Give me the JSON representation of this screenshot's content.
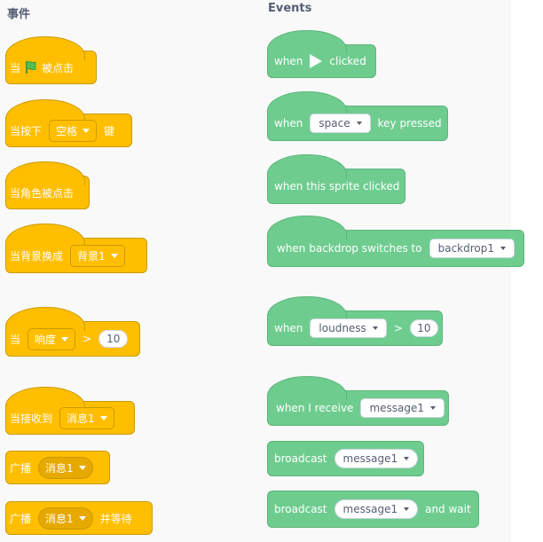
{
  "left": {
    "title": "事件",
    "b1": {
      "pre": "当",
      "post": "被点击"
    },
    "b2": {
      "pre": "当按下",
      "dd": "空格",
      "post": "键"
    },
    "b3": {
      "text": "当角色被点击"
    },
    "b4": {
      "pre": "当背景换成",
      "dd": "背景1"
    },
    "b5": {
      "pre": "当",
      "dd": "响度",
      "op": ">",
      "val": "10"
    },
    "b6": {
      "pre": "当接收到",
      "dd": "消息1"
    },
    "b7": {
      "pre": "广播",
      "dd": "消息1"
    },
    "b8": {
      "pre": "广播",
      "dd": "消息1",
      "post": "并等待"
    }
  },
  "right": {
    "title": "Events",
    "b1": {
      "pre": "when",
      "post": "clicked"
    },
    "b2": {
      "pre": "when",
      "dd": "space",
      "post": "key pressed"
    },
    "b3": {
      "text": "when this sprite clicked"
    },
    "b4": {
      "pre": "when backdrop switches to",
      "dd": "backdrop1"
    },
    "b5": {
      "pre": "when",
      "dd": "loudness",
      "op": ">",
      "val": "10"
    },
    "b6": {
      "pre": "when I receive",
      "dd": "message1"
    },
    "b7": {
      "pre": "broadcast",
      "dd": "message1"
    },
    "b8": {
      "pre": "broadcast",
      "dd": "message1",
      "post": "and wait"
    }
  },
  "colors": {
    "events_yellow": "#ffbf00",
    "events_green": "#6fcc8f",
    "flag_green": "#4cbf56"
  }
}
